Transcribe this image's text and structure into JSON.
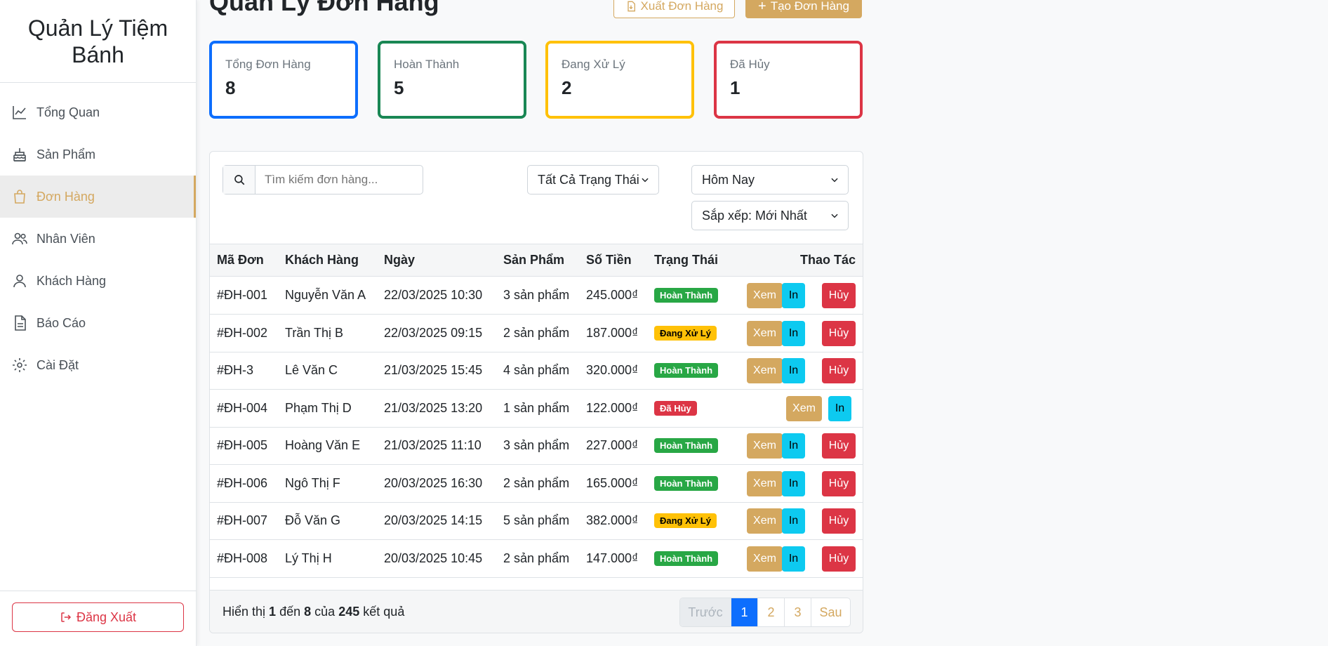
{
  "brand": "Quản Lý Tiệm Bánh",
  "nav": [
    {
      "label": "Tổng Quan",
      "icon": "chart-line-icon"
    },
    {
      "label": "Sản Phẩm",
      "icon": "cake-icon"
    },
    {
      "label": "Đơn Hàng",
      "icon": "shopping-bag-icon",
      "active": true
    },
    {
      "label": "Nhân Viên",
      "icon": "people-icon"
    },
    {
      "label": "Khách Hàng",
      "icon": "person-icon"
    },
    {
      "label": "Báo Cáo",
      "icon": "document-icon"
    },
    {
      "label": "Cài Đặt",
      "icon": "gear-icon"
    }
  ],
  "logout_label": "Đăng Xuất",
  "header": {
    "title": "Quản Lý Đơn Hàng",
    "export_label": "Xuất Đơn Hàng",
    "create_label": "Tạo Đơn Hàng"
  },
  "stats": [
    {
      "label": "Tổng Đơn Hàng",
      "value": "8",
      "color": "#0d6efd"
    },
    {
      "label": "Hoàn Thành",
      "value": "5",
      "color": "#198754"
    },
    {
      "label": "Đang Xử Lý",
      "value": "2",
      "color": "#ffc107"
    },
    {
      "label": "Đã Hủy",
      "value": "1",
      "color": "#dc3545"
    }
  ],
  "filters": {
    "search_placeholder": "Tìm kiếm đơn hàng...",
    "status": "Tất Cả Trạng Thái",
    "date": "Hôm Nay",
    "sort": "Sắp xếp: Mới Nhất"
  },
  "columns": [
    "Mã Đơn",
    "Khách Hàng",
    "Ngày",
    "Sản Phẩm",
    "Số Tiền",
    "Trạng Thái",
    "Thao Tác"
  ],
  "actions": {
    "view": "Xem",
    "print": "In",
    "cancel": "Hủy"
  },
  "status_colors": {
    "Hoàn Thành": "#28a745",
    "Đang Xử Lý": "#ffc107",
    "Đã Hủy": "#dc3545"
  },
  "orders": [
    {
      "id": "#ĐH-001",
      "customer": "Nguyễn Văn A",
      "date": "22/03/2025 10:30",
      "products": "3 sản phẩm",
      "amount": "245.000₫",
      "status": "Hoàn Thành"
    },
    {
      "id": "#ĐH-002",
      "customer": "Trần Thị B",
      "date": "22/03/2025 09:15",
      "products": "2 sản phẩm",
      "amount": "187.000₫",
      "status": "Đang Xử Lý"
    },
    {
      "id": "#ĐH-3",
      "customer": "Lê Văn C",
      "date": "21/03/2025 15:45",
      "products": "4 sản phẩm",
      "amount": "320.000₫",
      "status": "Hoàn Thành"
    },
    {
      "id": "#ĐH-004",
      "customer": "Phạm Thị D",
      "date": "21/03/2025 13:20",
      "products": "1 sản phẩm",
      "amount": "122.000₫",
      "status": "Đã Hủy"
    },
    {
      "id": "#ĐH-005",
      "customer": "Hoàng Văn E",
      "date": "21/03/2025 11:10",
      "products": "3 sản phẩm",
      "amount": "227.000₫",
      "status": "Hoàn Thành"
    },
    {
      "id": "#ĐH-006",
      "customer": "Ngô Thị F",
      "date": "20/03/2025 16:30",
      "products": "2 sản phẩm",
      "amount": "165.000₫",
      "status": "Hoàn Thành"
    },
    {
      "id": "#ĐH-007",
      "customer": "Đỗ Văn G",
      "date": "20/03/2025 14:15",
      "products": "5 sản phẩm",
      "amount": "382.000₫",
      "status": "Đang Xử Lý"
    },
    {
      "id": "#ĐH-008",
      "customer": "Lý Thị H",
      "date": "20/03/2025 10:45",
      "products": "2 sản phẩm",
      "amount": "147.000₫",
      "status": "Hoàn Thành"
    }
  ],
  "footer": {
    "prefix": "Hiển thị",
    "from": "1",
    "mid1": "đến",
    "to": "8",
    "mid2": "của",
    "total": "245",
    "suffix": "kết quả"
  },
  "pagination": {
    "prev": "Trước",
    "pages": [
      "1",
      "2",
      "3"
    ],
    "next": "Sau",
    "current": "1"
  }
}
